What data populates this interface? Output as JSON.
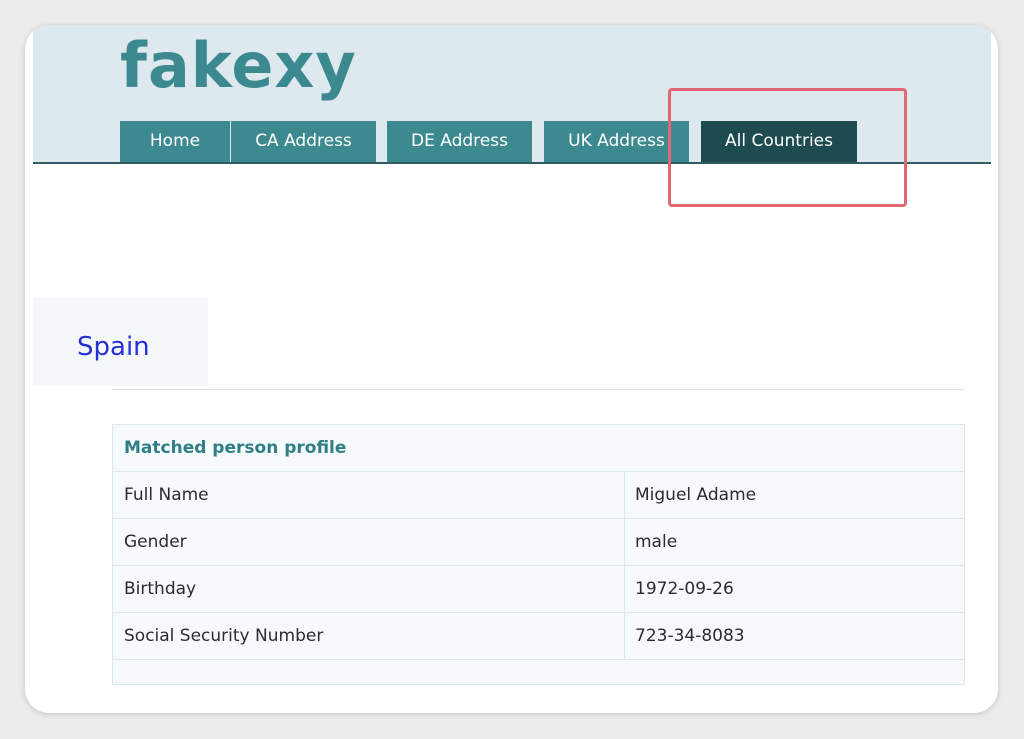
{
  "site": {
    "logo": "fakexy"
  },
  "nav": {
    "tabs": [
      {
        "label": "Home"
      },
      {
        "label": "CA Address"
      },
      {
        "label": "DE Address"
      },
      {
        "label": "UK Address"
      },
      {
        "label": "All Countries",
        "active": true
      }
    ]
  },
  "country": {
    "title": "Spain"
  },
  "profile": {
    "header": "Matched person profile",
    "rows": [
      {
        "label": "Full Name",
        "value": "Miguel Adame"
      },
      {
        "label": "Gender",
        "value": "male"
      },
      {
        "label": "Birthday",
        "value": "1972-09-26"
      },
      {
        "label": "Social Security Number",
        "value": "723-34-8083"
      }
    ]
  },
  "colors": {
    "brand": "#3c8a8f",
    "nav_active": "#1d4b50",
    "header_bg": "#dde9ef",
    "highlight": "#e46673",
    "country_title": "#2530d8"
  }
}
